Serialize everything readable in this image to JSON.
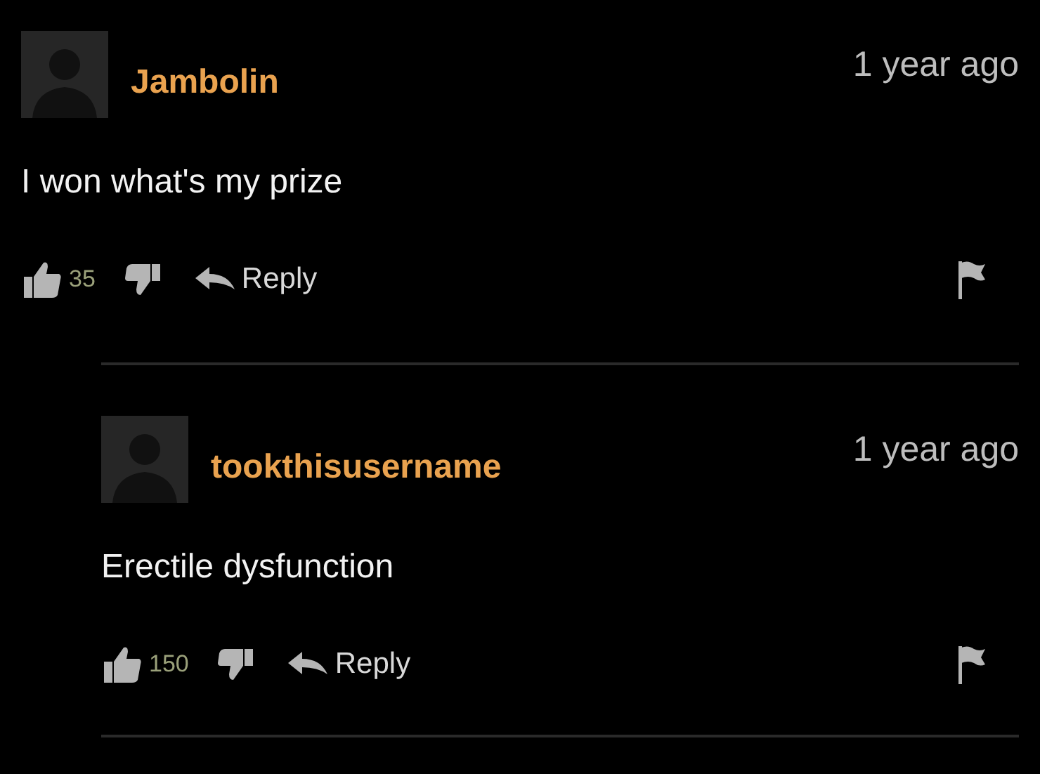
{
  "comments": [
    {
      "author": "Jambolin",
      "time": "1 year ago",
      "text": "I won what's my prize",
      "likes": "35",
      "reply_label": "Reply",
      "replies": [
        {
          "author": "tookthisusername",
          "time": "1 year ago",
          "text": "Erectile dysfunction",
          "likes": "150",
          "reply_label": "Reply"
        }
      ]
    }
  ]
}
